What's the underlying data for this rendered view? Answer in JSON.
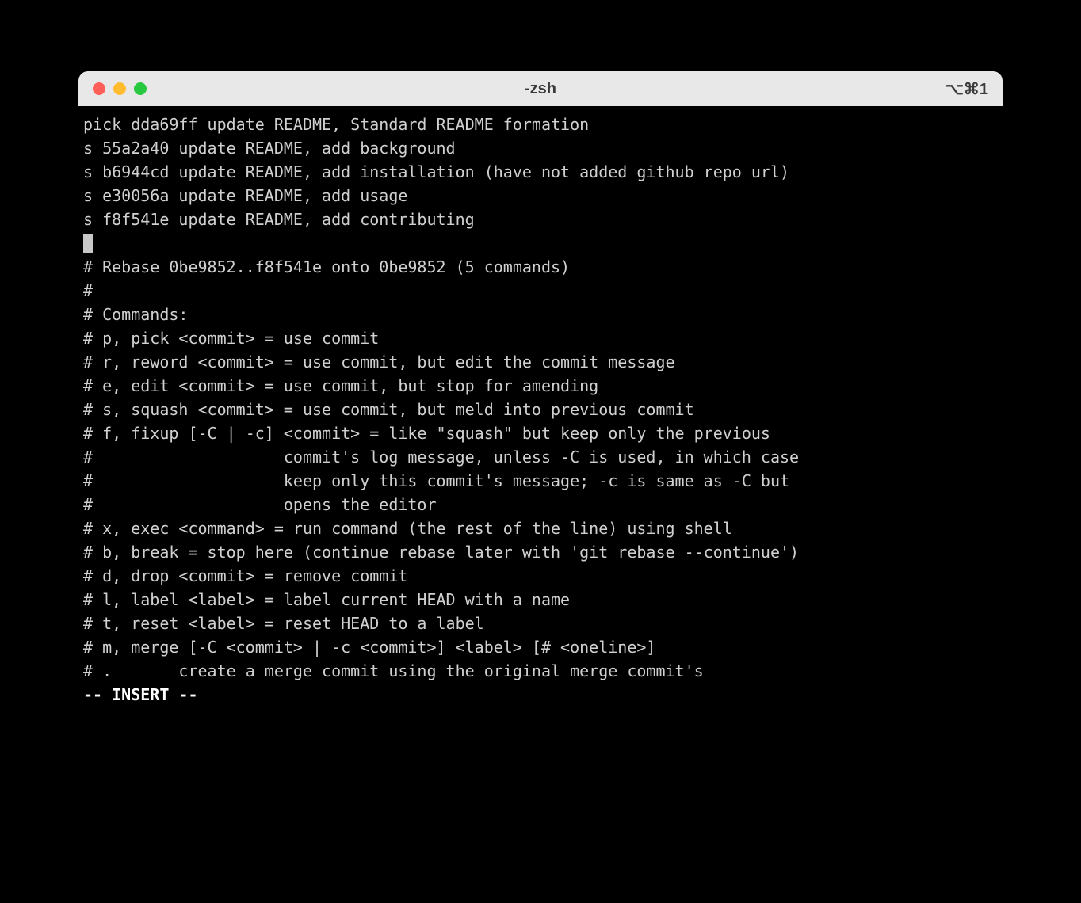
{
  "window": {
    "title": "-zsh",
    "shortcut": "⌥⌘1"
  },
  "editor": {
    "lines": [
      "pick dda69ff update README, Standard README formation",
      "s 55a2a40 update README, add background",
      "s b6944cd update README, add installation (have not added github repo url)",
      "s e30056a update README, add usage",
      "s f8f541e update README, add contributing"
    ],
    "cursor_line": "",
    "comment_lines": [
      "# Rebase 0be9852..f8f541e onto 0be9852 (5 commands)",
      "#",
      "# Commands:",
      "# p, pick <commit> = use commit",
      "# r, reword <commit> = use commit, but edit the commit message",
      "# e, edit <commit> = use commit, but stop for amending",
      "# s, squash <commit> = use commit, but meld into previous commit",
      "# f, fixup [-C | -c] <commit> = like \"squash\" but keep only the previous",
      "#                    commit's log message, unless -C is used, in which case",
      "#                    keep only this commit's message; -c is same as -C but",
      "#                    opens the editor",
      "# x, exec <command> = run command (the rest of the line) using shell",
      "# b, break = stop here (continue rebase later with 'git rebase --continue')",
      "# d, drop <commit> = remove commit",
      "# l, label <label> = label current HEAD with a name",
      "# t, reset <label> = reset HEAD to a label",
      "# m, merge [-C <commit> | -c <commit>] <label> [# <oneline>]",
      "# .       create a merge commit using the original merge commit's"
    ],
    "mode_line": "-- INSERT --"
  }
}
